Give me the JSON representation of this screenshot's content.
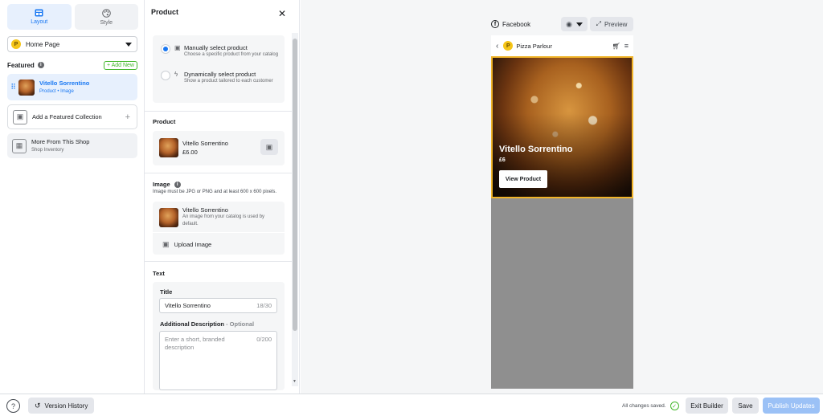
{
  "sidebar": {
    "tabs": [
      {
        "label": "Layout",
        "icon": "layout-icon",
        "active": true
      },
      {
        "label": "Style",
        "icon": "palette-icon",
        "active": false
      }
    ],
    "page_select": {
      "badge": "P",
      "value": "Home Page"
    },
    "featured": {
      "title": "Featured",
      "add_new_label": "+ Add New"
    },
    "items": [
      {
        "title": "Vitello Sorrentino",
        "subtitle": "Product • Image"
      },
      {
        "title": "Add a Featured Collection",
        "subtitle": ""
      },
      {
        "title": "More From This Shop",
        "subtitle": "Shop Inventory"
      }
    ]
  },
  "panel": {
    "title": "Product",
    "close_icon": "close-icon",
    "selection": {
      "manual": {
        "title": "Manually select product",
        "desc": "Choose a specific product from your catalog",
        "selected": true
      },
      "dynamic": {
        "title": "Dynamically select product",
        "desc": "Show a product tailored to each customer",
        "selected": false
      }
    },
    "product_section": {
      "heading": "Product",
      "name": "Vitello Sorrentino",
      "price": "£6.00"
    },
    "image_section": {
      "heading": "Image",
      "note": "Image must be JPG or PNG and at least 600 x 600 pixels.",
      "image_name": "Vitello Sorrentino",
      "image_desc": "An image from your catalog is used by default.",
      "upload_label": "Upload Image"
    },
    "text_section": {
      "heading": "Text",
      "title_label": "Title",
      "title_value": "Vitello Sorrentino",
      "title_count": "18/30",
      "desc_label": "Additional Description",
      "desc_optional": " - Optional",
      "desc_placeholder": "Enter a short, branded description",
      "desc_count": "0/200"
    }
  },
  "preview": {
    "platform": "Facebook",
    "preview_label": "Preview",
    "shop_badge": "P",
    "shop_name": "Pizza Parlour",
    "hero_title": "Vitello Sorrentino",
    "hero_price": "£6",
    "view_button": "View Product"
  },
  "footer": {
    "help": "?",
    "version_history": "Version History",
    "saved_status": "All changes saved.",
    "exit_label": "Exit Builder",
    "save_label": "Save",
    "publish_label": "Publish Updates"
  },
  "colors": {
    "accent": "#1877f2",
    "success": "#42b72a",
    "highlight": "#f0b429"
  }
}
